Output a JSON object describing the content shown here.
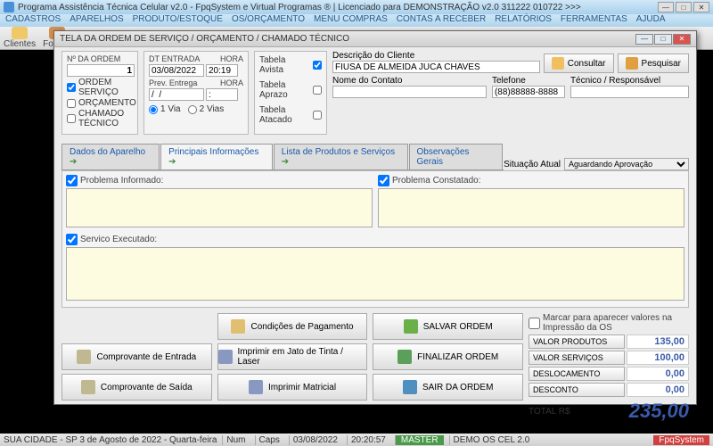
{
  "app": {
    "title": "Programa Assistência Técnica Celular v2.0 - FpqSystem e Virtual Programas ® | Licenciado para DEMONSTRAÇÃO v2.0 311222 010722 >>>",
    "menu": [
      "CADASTROS",
      "APARELHOS",
      "PRODUTO/ESTOQUE",
      "OS/ORÇAMENTO",
      "MENU COMPRAS",
      "CONTAS A RECEBER",
      "RELATÓRIOS",
      "FERRAMENTAS",
      "AJUDA"
    ],
    "toolbar": [
      {
        "label": "Clientes"
      },
      {
        "label": "Fornec"
      }
    ]
  },
  "dialog": {
    "title": "TELA DA ORDEM DE SERVIÇO / ORÇAMENTO / CHAMADO TÉCNICO",
    "ordem": {
      "label": "Nº DA ORDEM",
      "value": "1"
    },
    "tipos": {
      "ordem_servico": "ORDEM SERVIÇO",
      "orcamento": "ORÇAMENTO",
      "chamado": "CHAMADO TÉCNICO"
    },
    "datas": {
      "dt_entrada_lbl": "DT ENTRADA",
      "hora_lbl": "HORA",
      "dt_entrada": "03/08/2022",
      "hora": "20:19",
      "prev_entrega_lbl": "Prev. Entrega",
      "hora2_lbl": "HORA",
      "prev_entrega": "/  /",
      "hora2": ":",
      "via1": "1 Via",
      "via2": "2 Vias"
    },
    "tabelas": {
      "avista": "Tabela Avista",
      "aprazo": "Tabela Aprazo",
      "atacado": "Tabela Atacado"
    },
    "cliente": {
      "desc_lbl": "Descrição do Cliente",
      "desc": "FIUSA DE ALMEIDA JUCA CHAVES",
      "contato_lbl": "Nome do Contato",
      "contato": "",
      "telefone_lbl": "Telefone",
      "telefone": "(88)88888-8888",
      "tecnico_lbl": "Técnico / Responsável",
      "tecnico": ""
    },
    "buttons_top": {
      "consultar": "Consultar",
      "pesquisar": "Pesquisar"
    },
    "tabs": [
      "Dados do Aparelho",
      "Principais Informações",
      "Lista de Produtos e Serviços",
      "Observações Gerais"
    ],
    "situacao": {
      "label": "Situação Atual",
      "value": "Aguardando Aprovação"
    },
    "textareas": {
      "problema_informado": "Problema Informado:",
      "problema_constatado": "Problema Constatado:",
      "servico_executado": "Servico Executado:"
    },
    "buttons": {
      "cond_pag": "Condições de Pagamento",
      "comp_entrada": "Comprovante de Entrada",
      "comp_saida": "Comprovante de Saída",
      "imp_jato": "Imprimir em Jato de Tinta / Laser",
      "imp_matricial": "Imprimir Matricial",
      "salvar": "SALVAR ORDEM",
      "finalizar": "FINALIZAR ORDEM",
      "sair": "SAIR DA ORDEM"
    },
    "totals": {
      "marcar": "Marcar para aparecer valores na Impressão da OS",
      "produtos_lbl": "VALOR PRODUTOS",
      "produtos": "135,00",
      "servicos_lbl": "VALOR SERVIÇOS",
      "servicos": "100,00",
      "desloc_lbl": "DESLOCAMENTO",
      "desloc": "0,00",
      "desconto_lbl": "DESCONTO",
      "desconto": "0,00",
      "total_lbl": "TOTAL R$",
      "total": "235,00"
    }
  },
  "status": {
    "left": "SUA CIDADE - SP  3 de Agosto de 2022 - Quarta-feira",
    "num": "Num",
    "caps": "Caps",
    "date": "03/08/2022",
    "time": "20:20:57",
    "master": "MASTER",
    "demo": "DEMO OS CEL 2.0",
    "fpq": "FpqSystem"
  }
}
